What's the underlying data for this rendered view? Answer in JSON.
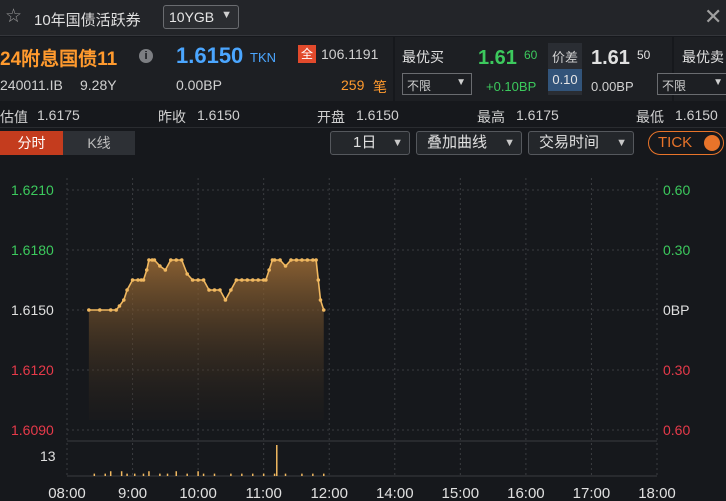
{
  "window": {
    "title": "10年国债活跃券",
    "bond_select": "10YGB",
    "star_icon": "star-icon",
    "close_icon": "close-icon"
  },
  "quote": {
    "bond_name": "24附息国债11",
    "info_icon": "i",
    "bond_code": "240011.IB",
    "bond_term": "9.28Y",
    "last_price": "1.6150",
    "last_source": "TKN",
    "last_bp": "0.00BP",
    "full_badge": "全",
    "full_price": "106.1191",
    "volume": "259",
    "volume_unit": "笔",
    "best_bid_label": "最优买",
    "bid_filter": "不限",
    "bid_price": "1.61",
    "bid_price_sub": "60",
    "bid_bp": "+0.10BP",
    "spread_label": "价差",
    "spread_value": "0.10",
    "ask_price": "1.61",
    "ask_price_sub": "50",
    "ask_bp": "0.00BP",
    "best_ask_label": "最优卖",
    "ask_filter": "不限"
  },
  "stats": {
    "valuation_label": "估值",
    "valuation": "1.6175",
    "prev_close_label": "昨收",
    "prev_close": "1.6150",
    "open_label": "开盘",
    "open": "1.6150",
    "high_label": "最高",
    "high": "1.6175",
    "low_label": "最低",
    "low": "1.6150"
  },
  "toolbar": {
    "tab_intraday": "分时",
    "tab_kline": "K线",
    "period_select": "1日",
    "overlay_select": "叠加曲线",
    "session_select": "交易时间",
    "tick_toggle": "TICK"
  },
  "colors": {
    "line": "#f0b860",
    "up": "#3cc95d",
    "down": "#e63a4a",
    "neutral": "#e0e0e0",
    "grid": "#3a3c40"
  },
  "chart_data": {
    "type": "line",
    "y_left_ticks": [
      "1.6210",
      "1.6180",
      "1.6150",
      "1.6120",
      "1.6090"
    ],
    "y_right_ticks": [
      "0.60",
      "0.30",
      "0BP",
      "0.30",
      "0.60"
    ],
    "x_ticks": [
      "08:00",
      "9:00",
      "10:00",
      "11:00",
      "12:00",
      "14:00",
      "15:00",
      "16:00",
      "17:00",
      "18:00"
    ],
    "ylim": [
      1.609,
      1.621
    ],
    "volume_axis_label": "13",
    "series": [
      {
        "x": [
          "08:20",
          "08:30",
          "08:40",
          "08:45",
          "08:48",
          "08:52",
          "08:55",
          "09:00",
          "09:05",
          "09:08",
          "09:10",
          "09:13",
          "09:15",
          "09:18",
          "09:20",
          "09:25",
          "09:30",
          "09:35",
          "09:40",
          "09:45",
          "09:50",
          "09:55",
          "10:00",
          "10:05",
          "10:10",
          "10:15",
          "10:20",
          "10:25",
          "10:30",
          "10:35",
          "10:40",
          "10:45",
          "10:50",
          "10:55",
          "11:00",
          "11:02",
          "11:05",
          "11:08",
          "11:10",
          "11:15",
          "11:20",
          "11:25",
          "11:30",
          "11:35",
          "11:40",
          "11:45",
          "11:48",
          "11:50",
          "11:52",
          "11:55"
        ],
        "y": [
          1.615,
          1.615,
          1.615,
          1.615,
          1.6152,
          1.6155,
          1.616,
          1.6165,
          1.6165,
          1.6165,
          1.6165,
          1.617,
          1.6175,
          1.6175,
          1.6175,
          1.6172,
          1.617,
          1.6175,
          1.6175,
          1.6175,
          1.6168,
          1.6165,
          1.6165,
          1.6165,
          1.616,
          1.616,
          1.616,
          1.6155,
          1.616,
          1.6165,
          1.6165,
          1.6165,
          1.6165,
          1.6165,
          1.6165,
          1.6165,
          1.617,
          1.6175,
          1.6175,
          1.6175,
          1.6172,
          1.6175,
          1.6175,
          1.6175,
          1.6175,
          1.6175,
          1.6175,
          1.6165,
          1.6155,
          1.615
        ]
      }
    ],
    "volume": {
      "x": [
        "08:25",
        "08:35",
        "08:40",
        "08:50",
        "08:55",
        "09:02",
        "09:10",
        "09:15",
        "09:25",
        "09:32",
        "09:40",
        "09:50",
        "10:00",
        "10:05",
        "10:15",
        "10:30",
        "10:40",
        "10:50",
        "11:00",
        "11:10",
        "11:12",
        "11:20",
        "11:35",
        "11:45",
        "11:55"
      ],
      "values": [
        1,
        1,
        2,
        2,
        1,
        1,
        1,
        2,
        1,
        1,
        2,
        1,
        2,
        1,
        1,
        1,
        1,
        1,
        1,
        1,
        13,
        1,
        1,
        1,
        1
      ]
    }
  }
}
